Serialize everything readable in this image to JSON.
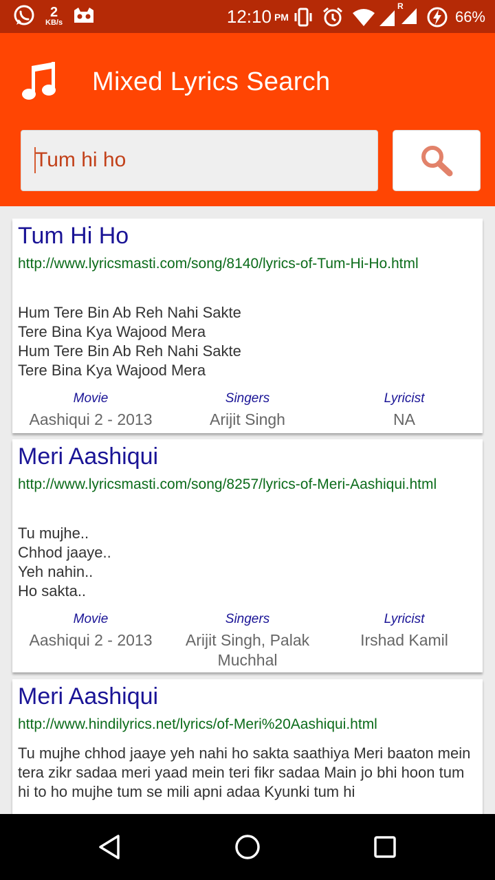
{
  "status_bar": {
    "net_speed_value": "2",
    "net_speed_unit": "KB/s",
    "time": "12:10",
    "ampm": "PM",
    "battery": "66%",
    "signal_badge": "R"
  },
  "app_bar": {
    "title": "Mixed Lyrics Search",
    "icon": "music-note-icon"
  },
  "search": {
    "value": "Tum hi ho",
    "button_icon": "search-icon"
  },
  "results": [
    {
      "title": "Tum Hi Ho",
      "url": "http://www.lyricsmasti.com/song/8140/lyrics-of-Tum-Hi-Ho.html",
      "lyrics": "Hum Tere Bin Ab Reh Nahi Sakte\nTere Bina Kya Wajood Mera\nHum Tere Bin Ab Reh Nahi Sakte\nTere Bina Kya Wajood Mera",
      "movie_label": "Movie",
      "movie": "Aashiqui 2 - 2013",
      "singers_label": "Singers",
      "singers": "Arijit Singh",
      "lyricist_label": "Lyricist",
      "lyricist": "NA"
    },
    {
      "title": "Meri Aashiqui",
      "url": "http://www.lyricsmasti.com/song/8257/lyrics-of-Meri-Aashiqui.html",
      "lyrics": "Tu mujhe..\nChhod jaaye..\nYeh nahin..\nHo sakta..",
      "movie_label": "Movie",
      "movie": "Aashiqui 2 - 2013",
      "singers_label": "Singers",
      "singers": "Arijit Singh,  Palak Muchhal",
      "lyricist_label": "Lyricist",
      "lyricist": "Irshad Kamil"
    },
    {
      "title": "Meri Aashiqui",
      "url": "http://www.hindilyrics.net/lyrics/of-Meri%20Aashiqui.html",
      "lyrics": "Tu mujhe chhod jaaye yeh nahi ho sakta saathiya  Meri baaton mein tera zikr sadaa meri yaad mein teri fikr sadaa  Main jo bhi hoon tum hi to ho mujhe tum se mili apni adaa  Kyunki tum hi"
    }
  ],
  "nav_bar": {
    "back_icon": "back-triangle-icon",
    "home_icon": "home-circle-icon",
    "recents_icon": "recents-square-icon"
  },
  "colors": {
    "status_bar": "#b52a06",
    "app_bar": "#ff4503",
    "title_text": "#1a1496",
    "url_text": "#0b6b1a"
  }
}
